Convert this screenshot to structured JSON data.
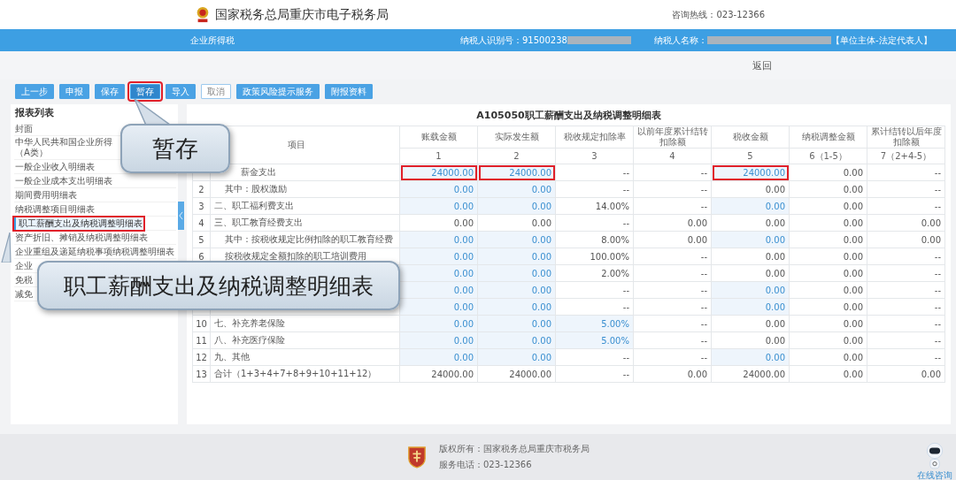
{
  "header": {
    "title": "国家税务总局重庆市电子税务局",
    "hotline": "咨询热线：023-12366"
  },
  "infobar": {
    "tax_type": "企业所得税",
    "taxpayer_id_label": "纳税人识别号：91500238",
    "taxpayer_name_label": "纳税人名称：",
    "taxpayer_role": "【单位主体-法定代表人】"
  },
  "back_link": "返回",
  "toolbar": [
    {
      "label": "上一步",
      "kind": "primary",
      "boxed": false
    },
    {
      "label": "申报",
      "kind": "primary",
      "boxed": false
    },
    {
      "label": "保存",
      "kind": "primary",
      "boxed": false
    },
    {
      "label": "暂存",
      "kind": "primary",
      "boxed": true
    },
    {
      "label": "导入",
      "kind": "primary",
      "boxed": false
    },
    {
      "label": "取消",
      "kind": "outline",
      "boxed": false
    },
    {
      "label": "政策风险提示服务",
      "kind": "primary",
      "boxed": false
    },
    {
      "label": "附报资料",
      "kind": "primary",
      "boxed": false
    }
  ],
  "sidebar": {
    "title": "报表列表",
    "items": [
      {
        "lines": [
          "封面"
        ],
        "selected": false,
        "boxed": false
      },
      {
        "lines": [
          "中华人民共和国企业所得",
          "（A类）"
        ],
        "selected": false,
        "boxed": false
      },
      {
        "lines": [
          "一般企业收入明细表"
        ],
        "selected": false,
        "boxed": false
      },
      {
        "lines": [
          "一般企业成本支出明细表"
        ],
        "selected": false,
        "boxed": false
      },
      {
        "lines": [
          "期间费用明细表"
        ],
        "selected": false,
        "boxed": false
      },
      {
        "lines": [
          "纳税调整项目明细表"
        ],
        "selected": false,
        "boxed": false
      },
      {
        "lines": [
          "职工薪酬支出及纳税调整明细表"
        ],
        "selected": true,
        "boxed": true
      },
      {
        "lines": [
          "资产折旧、摊销及纳税调整明细表"
        ],
        "selected": false,
        "boxed": false
      },
      {
        "lines": [
          "企业重组及递延纳税事项纳税调整明细表"
        ],
        "selected": false,
        "boxed": false
      },
      {
        "lines": [
          "企业"
        ],
        "selected": false,
        "boxed": false
      },
      {
        "lines": [
          "免税"
        ],
        "selected": false,
        "boxed": false
      },
      {
        "lines": [
          "减免"
        ],
        "selected": false,
        "boxed": false
      }
    ]
  },
  "table": {
    "title": "A105050职工薪酬支出及纳税调整明细表",
    "item_header": "项目",
    "columns": [
      {
        "label": "账载金额",
        "index": "1"
      },
      {
        "label": "实际发生额",
        "index": "2"
      },
      {
        "label": "税收规定扣除率",
        "index": "3"
      },
      {
        "label": "以前年度累计结转扣除额",
        "index": "4"
      },
      {
        "label": "税收金额",
        "index": "5"
      },
      {
        "label": "纳税调整金额",
        "index": "6（1-5）"
      },
      {
        "label": "累计结转以后年度扣除额",
        "index": "7（2+4-5）"
      }
    ],
    "rows": [
      {
        "item": "薪金支出",
        "kind": "main",
        "cells": [
          {
            "text": "24000.00",
            "editable": true,
            "boxed": true
          },
          {
            "text": "24000.00",
            "editable": true,
            "boxed": true
          },
          {
            "text": "--",
            "editable": false,
            "boxed": false
          },
          {
            "text": "--",
            "editable": false,
            "boxed": false
          },
          {
            "text": "24000.00",
            "editable": true,
            "boxed": true
          },
          {
            "text": "0.00",
            "editable": false,
            "boxed": false
          },
          {
            "text": "--",
            "editable": false,
            "boxed": false
          }
        ]
      },
      {
        "no": "2",
        "item": "其中：股权激励",
        "kind": "sub",
        "cells": [
          {
            "text": "0.00",
            "editable": true,
            "boxed": false
          },
          {
            "text": "0.00",
            "editable": true,
            "boxed": false
          },
          {
            "text": "--",
            "editable": false,
            "boxed": false
          },
          {
            "text": "--",
            "editable": false,
            "boxed": false
          },
          {
            "text": "0.00",
            "editable": false,
            "boxed": false
          },
          {
            "text": "0.00",
            "editable": false,
            "boxed": false
          },
          {
            "text": "--",
            "editable": false,
            "boxed": false
          }
        ]
      },
      {
        "no": "3",
        "item": "二、职工福利费支出",
        "kind": "main",
        "cells": [
          {
            "text": "0.00",
            "editable": true,
            "boxed": false
          },
          {
            "text": "0.00",
            "editable": true,
            "boxed": false
          },
          {
            "text": "14.00%",
            "editable": false,
            "boxed": false
          },
          {
            "text": "--",
            "editable": false,
            "boxed": false
          },
          {
            "text": "0.00",
            "editable": true,
            "boxed": false
          },
          {
            "text": "0.00",
            "editable": false,
            "boxed": false
          },
          {
            "text": "--",
            "editable": false,
            "boxed": false
          }
        ]
      },
      {
        "no": "4",
        "item": "三、职工教育经费支出",
        "kind": "main",
        "cells": [
          {
            "text": "0.00",
            "editable": false,
            "boxed": false
          },
          {
            "text": "0.00",
            "editable": false,
            "boxed": false
          },
          {
            "text": "--",
            "editable": false,
            "boxed": false
          },
          {
            "text": "0.00",
            "editable": false,
            "boxed": false
          },
          {
            "text": "0.00",
            "editable": false,
            "boxed": false
          },
          {
            "text": "0.00",
            "editable": false,
            "boxed": false
          },
          {
            "text": "0.00",
            "editable": false,
            "boxed": false
          }
        ]
      },
      {
        "no": "5",
        "item": "其中：按税收规定比例扣除的职工教育经费",
        "kind": "sub",
        "cells": [
          {
            "text": "0.00",
            "editable": true,
            "boxed": false
          },
          {
            "text": "0.00",
            "editable": true,
            "boxed": false
          },
          {
            "text": "8.00%",
            "editable": false,
            "boxed": false
          },
          {
            "text": "0.00",
            "editable": false,
            "boxed": false
          },
          {
            "text": "0.00",
            "editable": true,
            "boxed": false
          },
          {
            "text": "0.00",
            "editable": false,
            "boxed": false
          },
          {
            "text": "0.00",
            "editable": false,
            "boxed": false
          }
        ]
      },
      {
        "no": "6",
        "item": "按税收规定全额扣除的职工培训费用",
        "kind": "sub",
        "cells": [
          {
            "text": "0.00",
            "editable": true,
            "boxed": false
          },
          {
            "text": "0.00",
            "editable": true,
            "boxed": false
          },
          {
            "text": "100.00%",
            "editable": false,
            "boxed": false
          },
          {
            "text": "--",
            "editable": false,
            "boxed": false
          },
          {
            "text": "0.00",
            "editable": false,
            "boxed": false
          },
          {
            "text": "0.00",
            "editable": false,
            "boxed": false
          },
          {
            "text": "--",
            "editable": false,
            "boxed": false
          }
        ]
      },
      {
        "kind": "main",
        "cells": [
          {
            "text": "0.00",
            "editable": true,
            "boxed": false
          },
          {
            "text": "0.00",
            "editable": true,
            "boxed": false
          },
          {
            "text": "2.00%",
            "editable": false,
            "boxed": false
          },
          {
            "text": "--",
            "editable": false,
            "boxed": false
          },
          {
            "text": "0.00",
            "editable": false,
            "boxed": false
          },
          {
            "text": "0.00",
            "editable": false,
            "boxed": false
          },
          {
            "text": "--",
            "editable": false,
            "boxed": false
          }
        ]
      },
      {
        "kind": "main",
        "cells": [
          {
            "text": "0.00",
            "editable": true,
            "boxed": false
          },
          {
            "text": "0.00",
            "editable": true,
            "boxed": false
          },
          {
            "text": "--",
            "editable": false,
            "boxed": false
          },
          {
            "text": "--",
            "editable": false,
            "boxed": false
          },
          {
            "text": "0.00",
            "editable": true,
            "boxed": false
          },
          {
            "text": "0.00",
            "editable": false,
            "boxed": false
          },
          {
            "text": "--",
            "editable": false,
            "boxed": false
          }
        ]
      },
      {
        "kind": "main",
        "cells": [
          {
            "text": "0.00",
            "editable": true,
            "boxed": false
          },
          {
            "text": "0.00",
            "editable": true,
            "boxed": false
          },
          {
            "text": "--",
            "editable": false,
            "boxed": false
          },
          {
            "text": "--",
            "editable": false,
            "boxed": false
          },
          {
            "text": "0.00",
            "editable": true,
            "boxed": false
          },
          {
            "text": "0.00",
            "editable": false,
            "boxed": false
          },
          {
            "text": "--",
            "editable": false,
            "boxed": false
          }
        ]
      },
      {
        "no": "10",
        "item": "七、补充养老保险",
        "kind": "main",
        "cells": [
          {
            "text": "0.00",
            "editable": true,
            "boxed": false
          },
          {
            "text": "0.00",
            "editable": true,
            "boxed": false
          },
          {
            "text": "5.00%",
            "editable": true,
            "boxed": false
          },
          {
            "text": "--",
            "editable": false,
            "boxed": false
          },
          {
            "text": "0.00",
            "editable": false,
            "boxed": false
          },
          {
            "text": "0.00",
            "editable": false,
            "boxed": false
          },
          {
            "text": "--",
            "editable": false,
            "boxed": false
          }
        ]
      },
      {
        "no": "11",
        "item": "八、补充医疗保险",
        "kind": "main",
        "cells": [
          {
            "text": "0.00",
            "editable": true,
            "boxed": false
          },
          {
            "text": "0.00",
            "editable": true,
            "boxed": false
          },
          {
            "text": "5.00%",
            "editable": true,
            "boxed": false
          },
          {
            "text": "--",
            "editable": false,
            "boxed": false
          },
          {
            "text": "0.00",
            "editable": false,
            "boxed": false
          },
          {
            "text": "0.00",
            "editable": false,
            "boxed": false
          },
          {
            "text": "--",
            "editable": false,
            "boxed": false
          }
        ]
      },
      {
        "no": "12",
        "item": "九、其他",
        "kind": "main",
        "cells": [
          {
            "text": "0.00",
            "editable": true,
            "boxed": false
          },
          {
            "text": "0.00",
            "editable": true,
            "boxed": false
          },
          {
            "text": "--",
            "editable": false,
            "boxed": false
          },
          {
            "text": "--",
            "editable": false,
            "boxed": false
          },
          {
            "text": "0.00",
            "editable": true,
            "boxed": false
          },
          {
            "text": "0.00",
            "editable": false,
            "boxed": false
          },
          {
            "text": "--",
            "editable": false,
            "boxed": false
          }
        ]
      },
      {
        "no": "13",
        "item": "合计（1+3+4+7+8+9+10+11+12）",
        "kind": "main",
        "cells": [
          {
            "text": "24000.00",
            "editable": false,
            "boxed": false
          },
          {
            "text": "24000.00",
            "editable": false,
            "boxed": false
          },
          {
            "text": "--",
            "editable": false,
            "boxed": false
          },
          {
            "text": "0.00",
            "editable": false,
            "boxed": false
          },
          {
            "text": "24000.00",
            "editable": false,
            "boxed": false
          },
          {
            "text": "0.00",
            "editable": false,
            "boxed": false
          },
          {
            "text": "0.00",
            "editable": false,
            "boxed": false
          }
        ]
      }
    ]
  },
  "callouts": [
    {
      "text": "暂存"
    },
    {
      "text": "职工薪酬支出及纳税调整明细表"
    }
  ],
  "footer": {
    "copyright": "版权所有：国家税务总局重庆市税务局",
    "phone": "服务电话：023-12366",
    "assistant": "在线咨询"
  }
}
